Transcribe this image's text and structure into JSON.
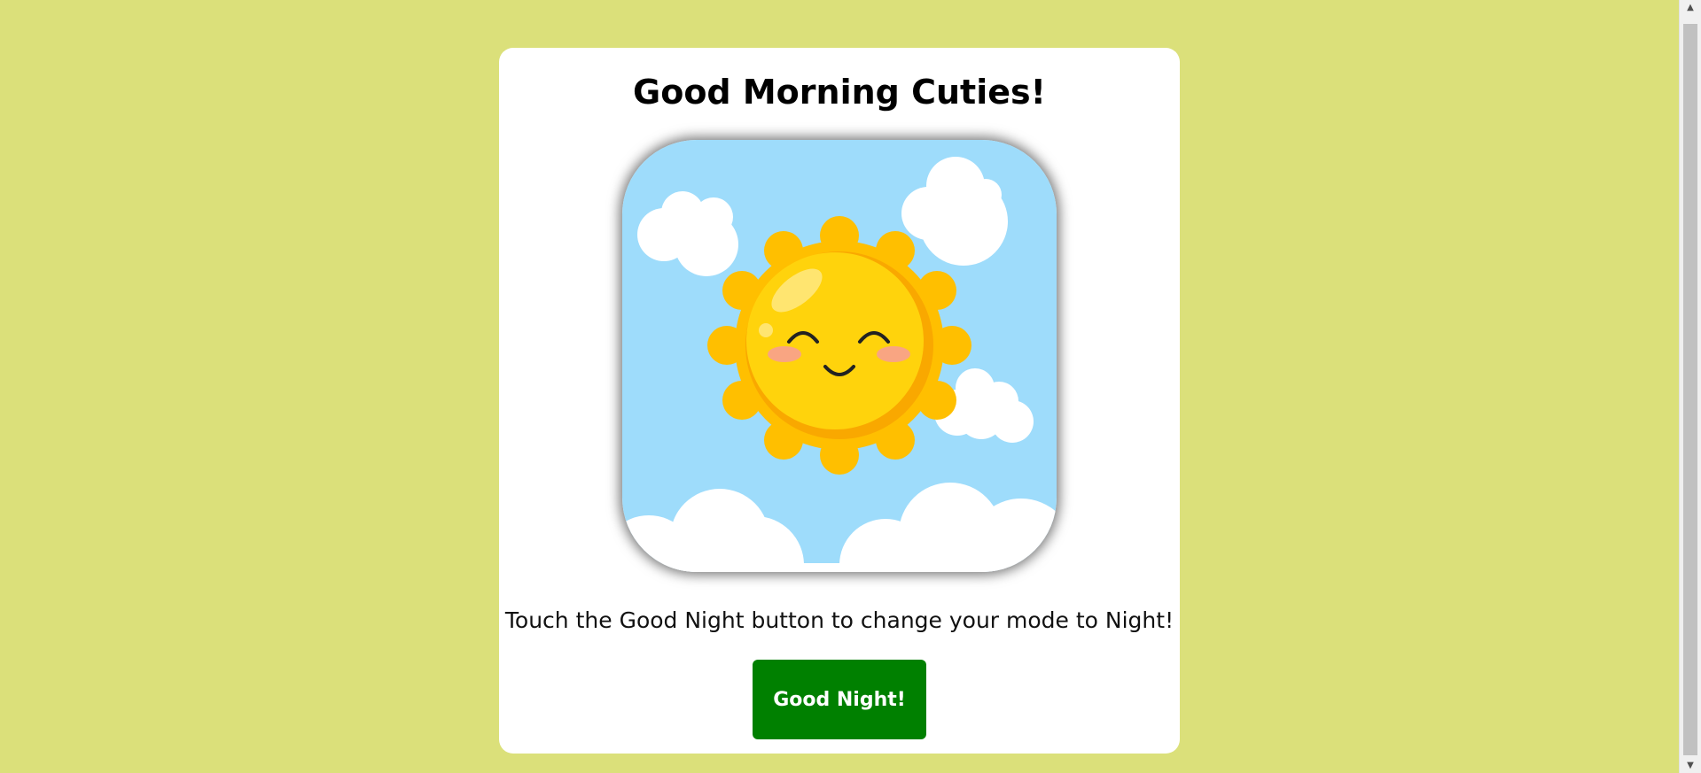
{
  "page": {
    "title": "Good Morning Cuties!",
    "instruction": "Touch the Good Night button to change your mode to Night!",
    "button_label": "Good Night!"
  },
  "image": {
    "icon": "smiling-sun-illustration"
  },
  "colors": {
    "background": "#dbe07a",
    "card": "#ffffff",
    "button": "#008000",
    "sky": "#9edcfb",
    "sun": "#ffd30c"
  }
}
